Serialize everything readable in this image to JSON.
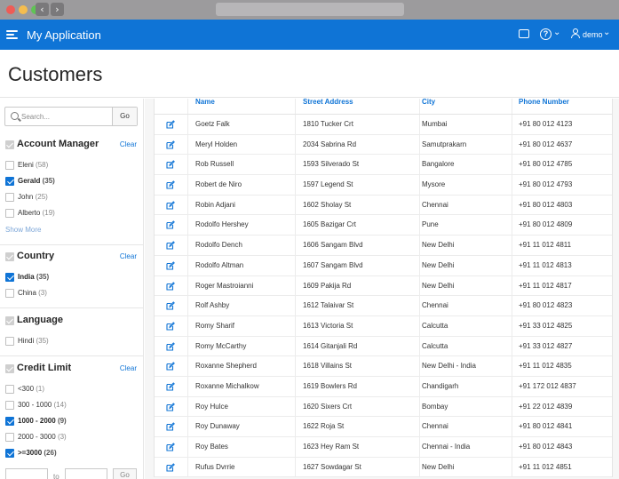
{
  "app": {
    "title": "My Application",
    "user": "demo"
  },
  "page": {
    "title": "Customers"
  },
  "search": {
    "placeholder": "Search...",
    "go_label": "Go"
  },
  "facets": [
    {
      "title": "Account Manager",
      "clear_label": "Clear",
      "options": [
        {
          "label": "Eleni",
          "count": "(58)",
          "checked": false
        },
        {
          "label": "Gerald",
          "count": "(35)",
          "checked": true
        },
        {
          "label": "John",
          "count": "(25)",
          "checked": false
        },
        {
          "label": "Alberto",
          "count": "(19)",
          "checked": false
        }
      ],
      "show_more_label": "Show More"
    },
    {
      "title": "Country",
      "clear_label": "Clear",
      "options": [
        {
          "label": "India",
          "count": "(35)",
          "checked": true
        },
        {
          "label": "China",
          "count": "(3)",
          "checked": false
        }
      ]
    },
    {
      "title": "Language",
      "clear_label": "",
      "options": [
        {
          "label": "Hindi",
          "count": "(35)",
          "checked": false
        }
      ]
    },
    {
      "title": "Credit Limit",
      "clear_label": "Clear",
      "options": [
        {
          "label": "<300",
          "count": "(1)",
          "checked": false
        },
        {
          "label": "300 - 1000",
          "count": "(14)",
          "checked": false
        },
        {
          "label": "1000 - 2000",
          "count": "(9)",
          "checked": true
        },
        {
          "label": "2000 - 3000",
          "count": "(3)",
          "checked": false
        },
        {
          "label": ">=3000",
          "count": "(26)",
          "checked": true
        }
      ],
      "range": {
        "to_label": "to",
        "go_label": "Go"
      }
    }
  ],
  "table": {
    "columns": [
      "Name",
      "Street Address",
      "City",
      "Phone Number"
    ],
    "rows": [
      {
        "name": "Goetz Falk",
        "street": "1810 Tucker Crt",
        "city": "Mumbai",
        "phone": "+91 80 012 4123"
      },
      {
        "name": "Meryl Holden",
        "street": "2034 Sabrina Rd",
        "city": "Samutprakarn",
        "phone": "+91 80 012 4637"
      },
      {
        "name": "Rob Russell",
        "street": "1593 Silverado St",
        "city": "Bangalore",
        "phone": "+91 80 012 4785"
      },
      {
        "name": "Robert de Niro",
        "street": "1597 Legend St",
        "city": "Mysore",
        "phone": "+91 80 012 4793"
      },
      {
        "name": "Robin Adjani",
        "street": "1602 Sholay St",
        "city": "Chennai",
        "phone": "+91 80 012 4803"
      },
      {
        "name": "Rodolfo Hershey",
        "street": "1605 Bazigar Crt",
        "city": "Pune",
        "phone": "+91 80 012 4809"
      },
      {
        "name": "Rodolfo Dench",
        "street": "1606 Sangam Blvd",
        "city": "New Delhi",
        "phone": "+91 11 012 4811"
      },
      {
        "name": "Rodolfo Altman",
        "street": "1607 Sangam Blvd",
        "city": "New Delhi",
        "phone": "+91 11 012 4813"
      },
      {
        "name": "Roger Mastroianni",
        "street": "1609 Pakija Rd",
        "city": "New Delhi",
        "phone": "+91 11 012 4817"
      },
      {
        "name": "Rolf Ashby",
        "street": "1612 Talaivar St",
        "city": "Chennai",
        "phone": "+91 80 012 4823"
      },
      {
        "name": "Romy Sharif",
        "street": "1613 Victoria St",
        "city": "Calcutta",
        "phone": "+91 33 012 4825"
      },
      {
        "name": "Romy McCarthy",
        "street": "1614 Gitanjali Rd",
        "city": "Calcutta",
        "phone": "+91 33 012 4827"
      },
      {
        "name": "Roxanne Shepherd",
        "street": "1618 Villains St",
        "city": "New Delhi - India",
        "phone": "+91 11 012 4835"
      },
      {
        "name": "Roxanne Michalkow",
        "street": "1619 Bowlers Rd",
        "city": "Chandigarh",
        "phone": "+91 172 012 4837"
      },
      {
        "name": "Roy Hulce",
        "street": "1620 Sixers Crt",
        "city": "Bombay",
        "phone": "+91 22 012 4839"
      },
      {
        "name": "Roy Dunaway",
        "street": "1622 Roja St",
        "city": "Chennai",
        "phone": "+91 80 012 4841"
      },
      {
        "name": "Roy Bates",
        "street": "1623 Hey Ram St",
        "city": "Chennai - India",
        "phone": "+91 80 012 4843"
      },
      {
        "name": "Rufus Dvrrie",
        "street": "1627 Sowdagar St",
        "city": "New Delhi",
        "phone": "+91 11 012 4851"
      }
    ]
  },
  "colors": {
    "accent": "#0f74d6",
    "chrome": "#9c9b9d"
  },
  "icons": {
    "menu": "hamburger-icon",
    "chat": "chat-icon",
    "help": "help-icon",
    "user": "user-icon",
    "search": "search-icon",
    "edit": "edit-icon"
  }
}
